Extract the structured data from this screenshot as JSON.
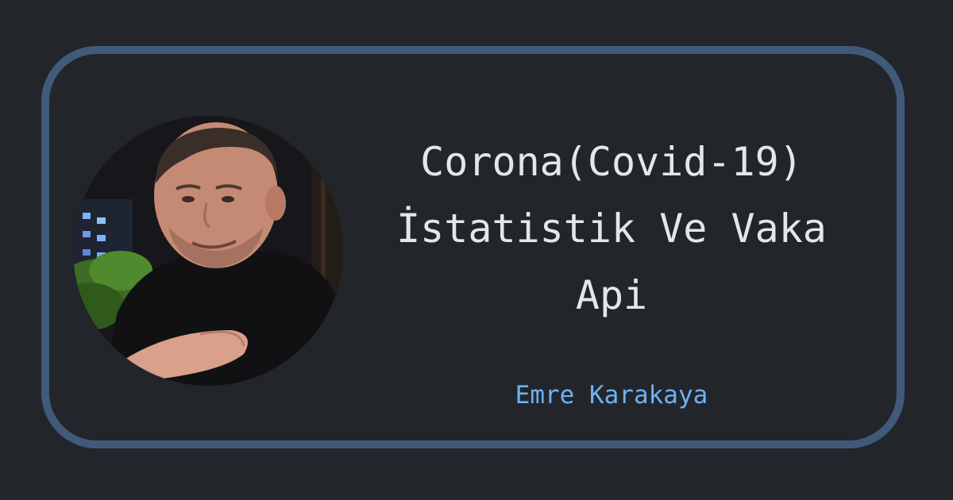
{
  "card": {
    "title": "Corona(Covid-19) İstatistik Ve Vaka Api",
    "author": "Emre Karakaya",
    "colors": {
      "background": "#22262b",
      "border": "#415a7a",
      "title": "#e3e6ea",
      "author": "#6eb1f2"
    },
    "avatar_icon": "profile-photo"
  }
}
